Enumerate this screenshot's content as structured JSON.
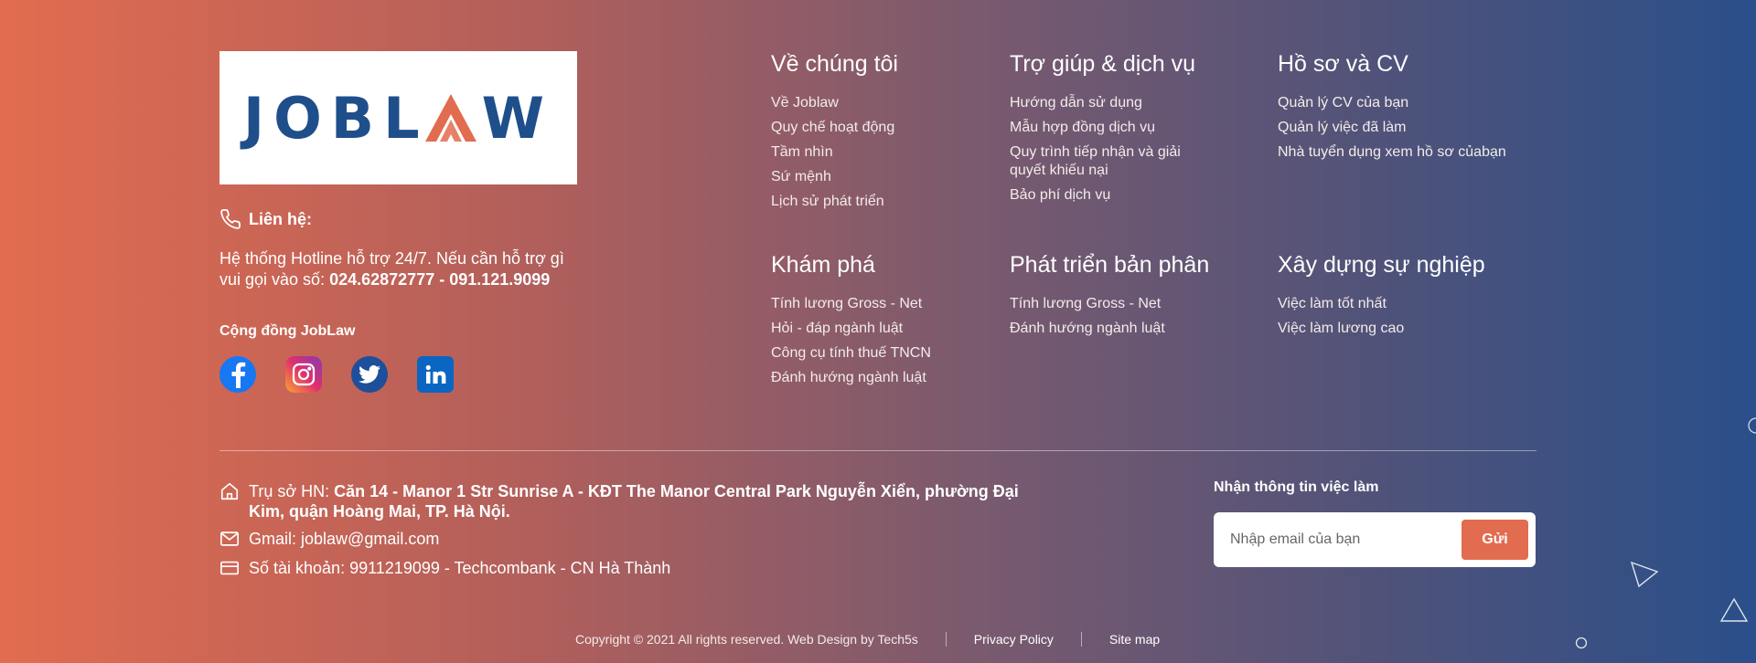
{
  "brand": {
    "logo_left": "JOBL",
    "logo_a": "A",
    "logo_right": "W"
  },
  "contact": {
    "heading": "Liên hệ:",
    "text": "Hệ thống Hotline hỗ trợ 24/7. Nếu cần hỗ trợ gì vui gọi vào số:",
    "hotline": "024.62872777 - 091.121.9099"
  },
  "community": {
    "label": "Cộng đồng JobLaw",
    "icons": [
      "facebook-icon",
      "instagram-icon",
      "twitter-icon",
      "linkedin-icon"
    ]
  },
  "columns": [
    {
      "title": "Về chúng tôi",
      "items": [
        "Về Joblaw",
        "Quy chế hoạt động",
        "Tầm nhìn",
        "Sứ mệnh",
        "Lịch sử phát triển"
      ]
    },
    {
      "title": "Trợ giúp & dịch vụ",
      "items": [
        "Hướng dẫn sử dụng",
        "Mẫu hợp đồng dịch vụ",
        "Quy trình tiếp nhận và giải quyết khiếu nại",
        "Bảo phí dịch vụ"
      ]
    },
    {
      "title": "Hồ sơ và CV",
      "items": [
        "Quản lý CV của bạn",
        "Quản lý việc đã làm",
        "Nhà tuyển dụng xem hồ sơ  củabạn"
      ]
    },
    {
      "title": "Khám phá",
      "items": [
        "Tính lương Gross - Net",
        "Hỏi - đáp ngành luật",
        "Công cụ tính thuế TNCN",
        "Đánh hướng ngành luật"
      ]
    },
    {
      "title": "Phát triển bản phân",
      "items": [
        "Tính lương Gross - Net",
        "Đánh hướng ngành luật"
      ]
    },
    {
      "title": "Xây dựng sự nghiệp",
      "items": [
        "Việc làm tốt nhất",
        "Việc làm lương cao"
      ]
    }
  ],
  "info": {
    "address_label": "Trụ sở HN:",
    "address": "Căn 14 - Manor 1 Str Sunrise A - KĐT The Manor Central Park Nguyễn Xiển, phường Đại Kim, quận Hoàng Mai, TP. Hà Nội.",
    "gmail_label": "Gmail:",
    "gmail": "joblaw@gmail.com",
    "account_label": "Số tài khoản:",
    "account": "9911219099 - Techcombank - CN Hà Thành"
  },
  "newsletter": {
    "label": "Nhận thông tin việc làm",
    "placeholder": "Nhập email của bạn",
    "button": "Gửi"
  },
  "bottom": {
    "copyright": "Copyright © 2021 All rights reserved. Web Design by  Tech5s",
    "privacy": "Privacy Policy",
    "sitemap": "Site map"
  },
  "colors": {
    "accent": "#e26c4f",
    "brand_blue": "#1f4f8b"
  }
}
